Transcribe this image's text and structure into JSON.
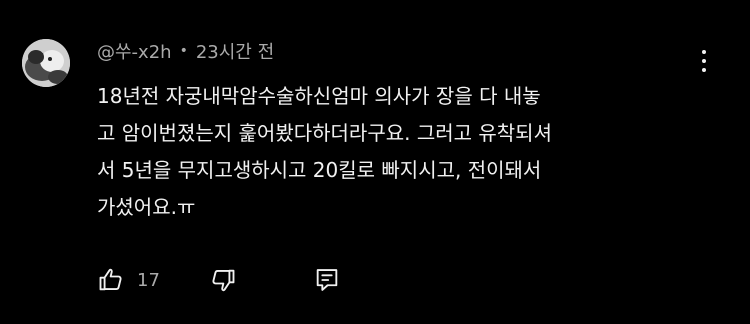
{
  "comment": {
    "author": "@쑤-x2h",
    "separator": "•",
    "timestamp": "23시간 전",
    "text_lines": [
      "18년전 자궁내막암수술하신엄마 의사가 장을 다 내놓",
      "고 암이번졌는지 훑어봤다하더라구요. 그러고 유착되셔",
      "서 5년을 무지고생하시고 20킬로 빠지시고, 전이돼서",
      "가셨어요.ㅠ"
    ],
    "like_count": "17"
  },
  "icons": {
    "more": "more-vertical-icon",
    "like": "thumbs-up-icon",
    "dislike": "thumbs-down-icon",
    "reply": "reply-comment-icon"
  },
  "colors": {
    "background": "#000000",
    "text_primary": "#f1f1f1",
    "text_secondary": "#aaaaaa"
  }
}
